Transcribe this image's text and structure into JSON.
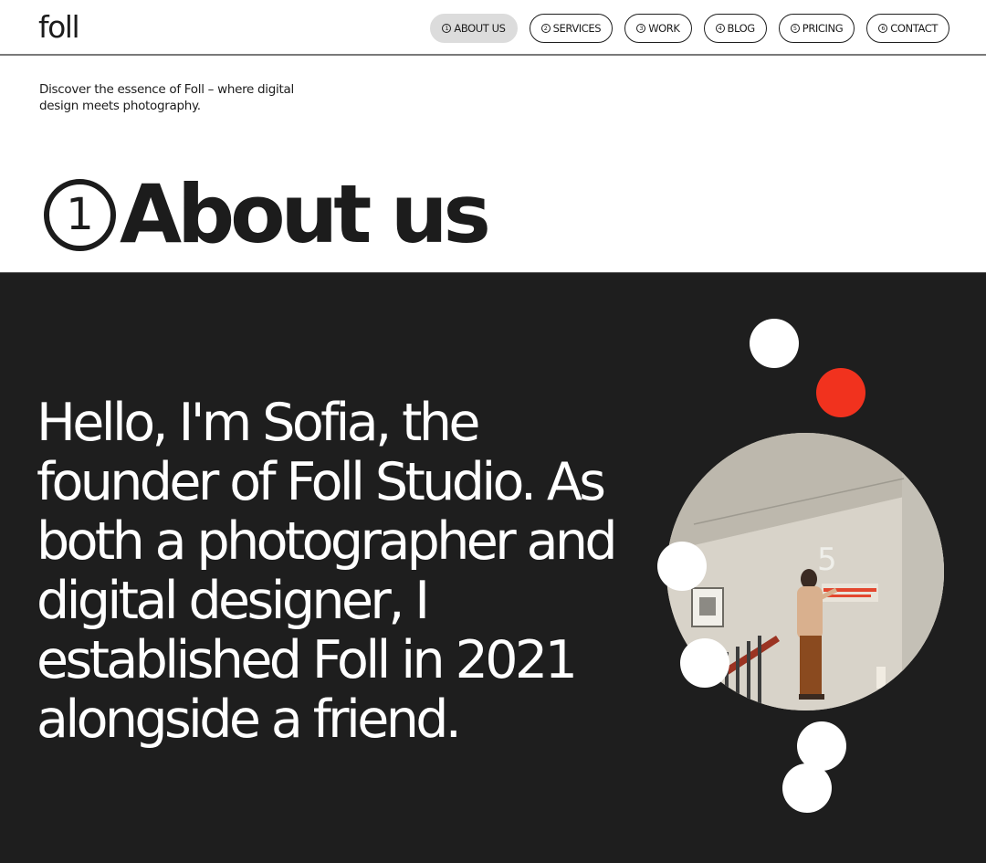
{
  "brand": {
    "logo": "foll"
  },
  "nav": {
    "items": [
      {
        "num": "1",
        "label": "ABOUT US",
        "active": true
      },
      {
        "num": "2",
        "label": "SERVICES",
        "active": false
      },
      {
        "num": "3",
        "label": "WORK",
        "active": false
      },
      {
        "num": "4",
        "label": "BLOG",
        "active": false
      },
      {
        "num": "5",
        "label": "PRICING",
        "active": false
      },
      {
        "num": "6",
        "label": "CONTACT",
        "active": false
      }
    ]
  },
  "intro": {
    "text": "Discover the essence of Foll – where digital design meets photography."
  },
  "section": {
    "number": "1",
    "title": "About us"
  },
  "about": {
    "text": "Hello, I'm Sofia, the founder of Foll Studio. As both a photographer and digital designer, I established Foll in 2021 alongside a friend."
  },
  "colors": {
    "dark_bg": "#1e1e1e",
    "accent": "#f1321e",
    "active_nav": "#dcdcdc"
  }
}
